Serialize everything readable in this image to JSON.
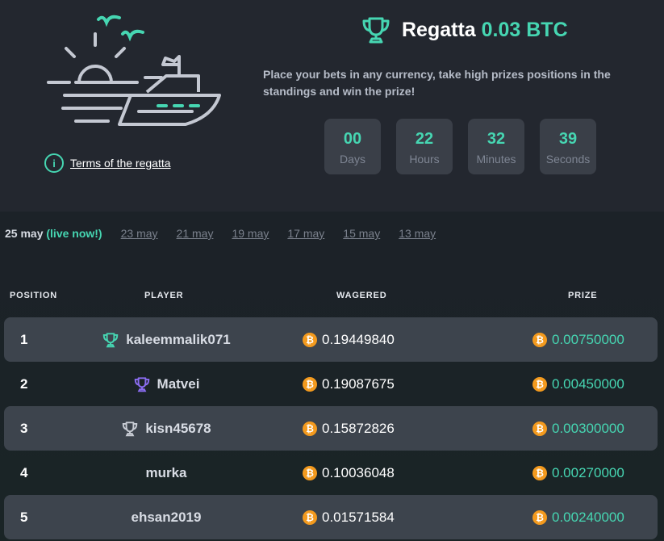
{
  "header": {
    "title": "Regatta",
    "prize": "0.03 BTC",
    "description": "Place your bets in any currency, take high prizes positions in the standings and win the prize!",
    "terms_link": "Terms of the regatta",
    "info_glyph": "i"
  },
  "countdown": [
    {
      "value": "00",
      "label": "Days"
    },
    {
      "value": "22",
      "label": "Hours"
    },
    {
      "value": "32",
      "label": "Minutes"
    },
    {
      "value": "39",
      "label": "Seconds"
    }
  ],
  "tabs": {
    "active_date": "25 may",
    "live_label": "(live now!)",
    "past": [
      "23 may",
      "21 may",
      "19 may",
      "17 may",
      "15 may",
      "13 may"
    ]
  },
  "table": {
    "headers": {
      "position": "POSITION",
      "player": "PLAYER",
      "wagered": "WAGERED",
      "prize": "PRIZE"
    },
    "currency_glyph": "₿",
    "rows": [
      {
        "position": "1",
        "player": "kaleemmalik071",
        "wagered": "0.19449840",
        "prize": "0.00750000",
        "trophy": "trophy-gold-icon"
      },
      {
        "position": "2",
        "player": "Matvei",
        "wagered": "0.19087675",
        "prize": "0.00450000",
        "trophy": "trophy-silver-icon"
      },
      {
        "position": "3",
        "player": "kisn45678",
        "wagered": "0.15872826",
        "prize": "0.00300000",
        "trophy": "trophy-bronze-icon"
      },
      {
        "position": "4",
        "player": "murka",
        "wagered": "0.10036048",
        "prize": "0.00270000"
      },
      {
        "position": "5",
        "player": "ehsan2019",
        "wagered": "0.01571584",
        "prize": "0.00240000"
      }
    ]
  },
  "colors": {
    "accent": "#46d6b2",
    "second_place": "#8a6cf0",
    "third_place": "#c8ccd4",
    "bitcoin": "#f39a1e"
  }
}
